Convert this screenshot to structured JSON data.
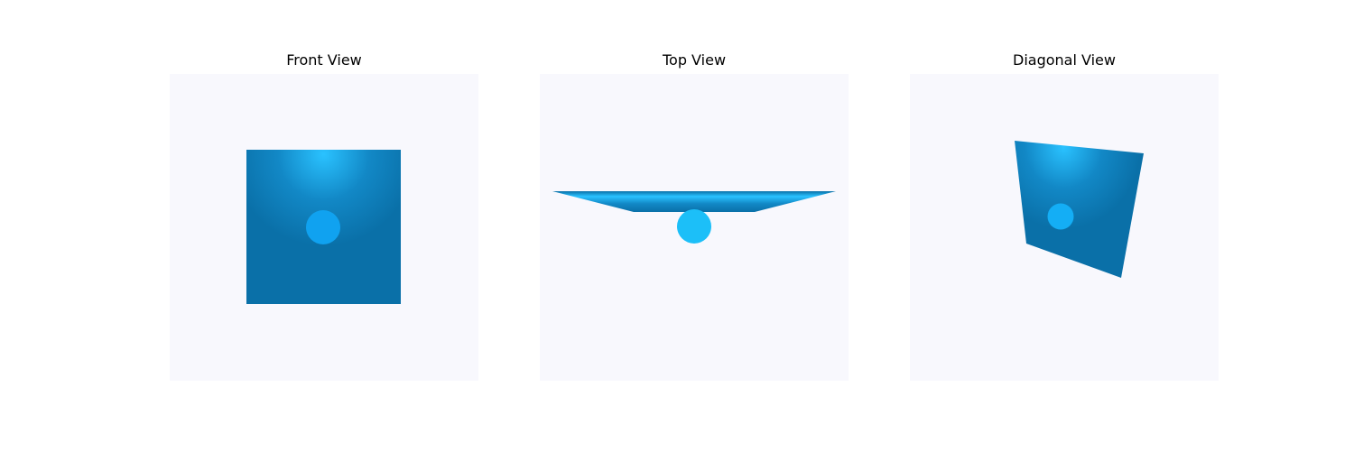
{
  "views": [
    {
      "id": "front",
      "title": "Front View"
    },
    {
      "id": "top",
      "title": "Top View"
    },
    {
      "id": "diag",
      "title": "Diagonal View"
    }
  ],
  "colors": {
    "background": "#f8f8fd",
    "plane_dark": "#0a70a8",
    "plane_highlight": "#2ac2ff",
    "front_sphere": "#10a2f0",
    "top_sphere": "#1cbff8",
    "diag_sphere": "#14aef5"
  }
}
